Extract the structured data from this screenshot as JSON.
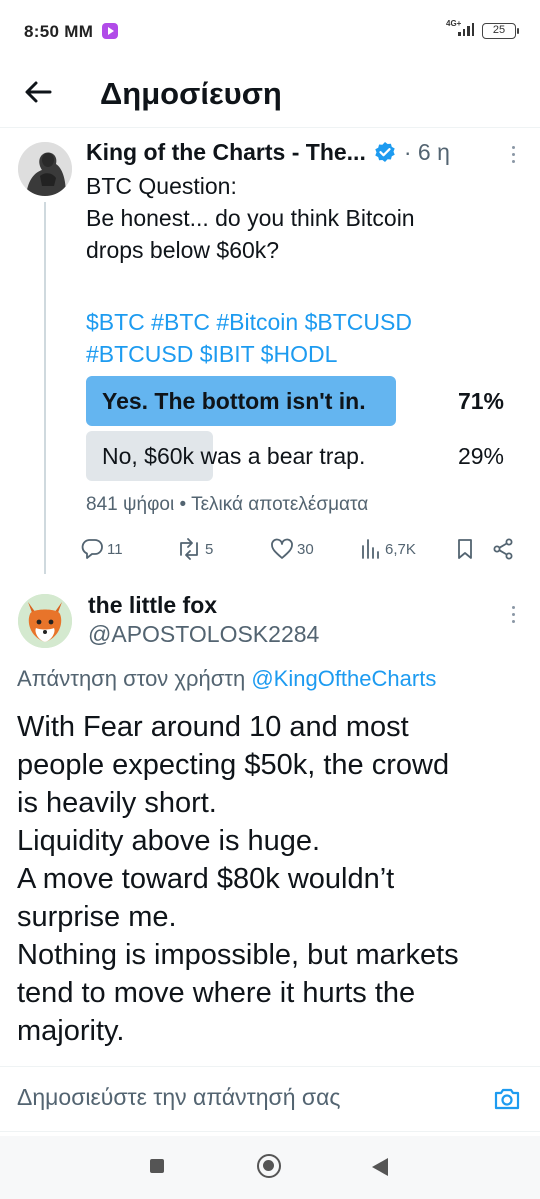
{
  "status_bar": {
    "time": "8:50 MM",
    "network": "4G+",
    "battery": "25"
  },
  "header": {
    "title": "Δημοσίευση"
  },
  "tweet": {
    "author_name": "King of the Charts - The...",
    "time": "· 6 η",
    "text_lines": [
      "BTC Question:",
      "Be honest... do you think Bitcoin",
      "drops below $60k?"
    ],
    "hashtag_lines": [
      "$BTC #BTC #Bitcoin $BTCUSD",
      "#BTCUSD $IBIT $HODL"
    ],
    "poll": {
      "options": [
        {
          "label": "Yes. The bottom isn't in.",
          "percent_text": "71%",
          "percent": 71,
          "winner": true
        },
        {
          "label": "No, $60k was a bear trap.",
          "percent_text": "29%",
          "percent": 29,
          "winner": false
        }
      ],
      "meta": "841 ψήφοι • Τελικά αποτελέσματα"
    },
    "actions": {
      "replies": "11",
      "reposts": "5",
      "likes": "30",
      "views": "6,7K"
    }
  },
  "reply": {
    "author_name": "the little fox",
    "handle": "@APOSTOLOSK2284",
    "replying_prefix": "Απάντηση στον χρήστη",
    "replying_mention": "@KingOftheCharts",
    "body_lines": [
      "With Fear around 10 and most",
      "people expecting $50k, the crowd",
      "is heavily short.",
      "Liquidity above is huge.",
      "A move toward $80k wouldn’t",
      "surprise me.",
      "Nothing is impossible, but markets",
      "tend to move where it hurts the",
      "majority."
    ]
  },
  "composer": {
    "placeholder": "Δημοσιεύστε την απάντησή σας"
  },
  "colors": {
    "accent": "#1d9bf0",
    "poll_winner": "#64b5f0",
    "poll_loser": "#e1e6ea",
    "secondary_text": "#536471"
  }
}
